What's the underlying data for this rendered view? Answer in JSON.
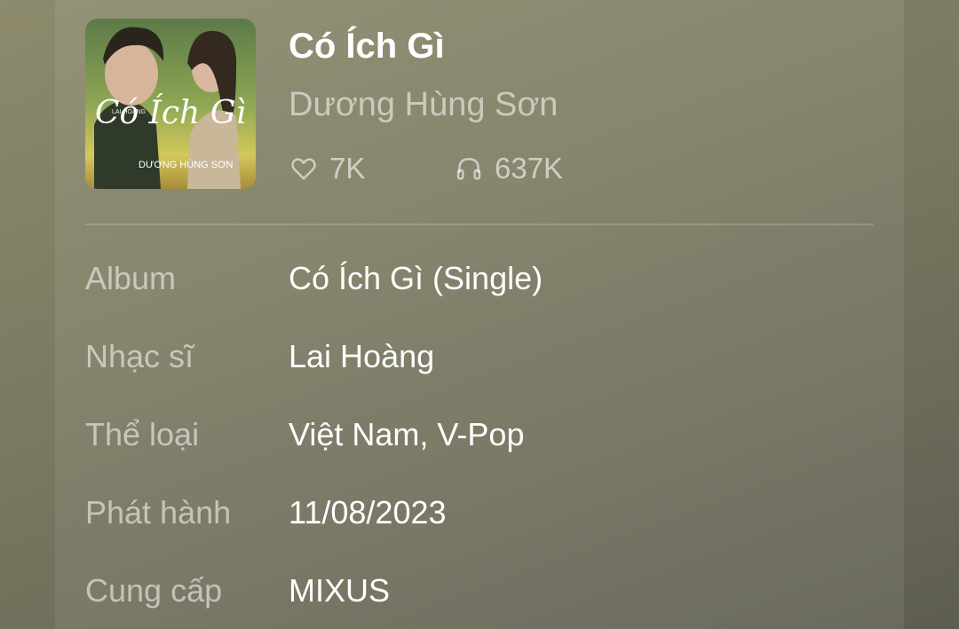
{
  "song": {
    "title": "Có Ích Gì",
    "artist": "Dương Hùng Sơn",
    "likes": "7K",
    "listens": "637K",
    "cover": {
      "title_art": "Có Ích Gì",
      "artist_art": "DƯƠNG HÙNG SƠN",
      "small_text": "LAI HOÀNG"
    }
  },
  "icons": {
    "likes": "heart-icon",
    "listens": "headphones-icon"
  },
  "details": [
    {
      "label": "Album",
      "value": "Có Ích Gì (Single)"
    },
    {
      "label": "Nhạc sĩ",
      "value": "Lai Hoàng"
    },
    {
      "label": "Thể loại",
      "value": "Việt Nam, V-Pop"
    },
    {
      "label": "Phát hành",
      "value": "11/08/2023"
    },
    {
      "label": "Cung cấp",
      "value": "MIXUS"
    }
  ]
}
